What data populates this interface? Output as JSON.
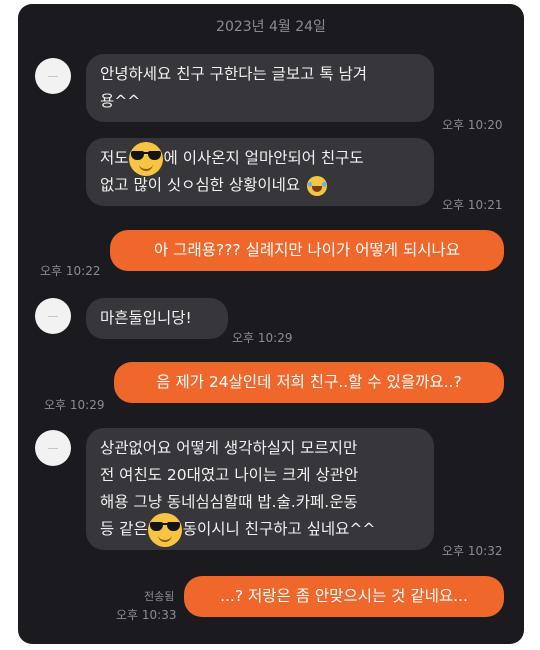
{
  "chat": {
    "date": "2023년 4월 24일",
    "messages": [
      {
        "line1": "안녕하세요 친구 구한다는 글보고 톡 남겨",
        "line2": "용^^",
        "time": "오후 10:20"
      },
      {
        "line1a": "저도",
        "line1b": "에 이사온지 얼마안되어 친구도",
        "line2": "없고 많이 싯ㅇ심한 상황이네요",
        "time": "오후 10:21",
        "emoji_a": "sunglasses-emoji",
        "emoji_b": "laughing-tears-emoji"
      },
      {
        "text": "아 그래용??? 실례지만 나이가 어떻게 되시나요",
        "time": "오후 10:22"
      },
      {
        "text": "마흔둘입니당!",
        "time": "오후 10:29"
      },
      {
        "text": "음 제가 24살인데 저희 친구..할 수 있을까요..?",
        "time": "오후 10:29"
      },
      {
        "line1": "상관없어요 어떻게 생각하실지 모르지만",
        "line2": "전 여친도 20대였고 나이는 크게 상관안",
        "line3": "해용 그냥 동네심심할때 밥.술.카페.운동",
        "line4a": "등 같은",
        "line4b": "동이시니 친구하고 싶네요^^",
        "time": "오후 10:32",
        "emoji": "sunglasses-emoji"
      },
      {
        "text": "...? 저랑은 좀 안맞으시는 것 같네요...",
        "time": "오후 10:33",
        "status": "전송됨"
      }
    ]
  },
  "colors": {
    "background": "#1b1b1f",
    "incoming": "#36363b",
    "outgoing": "#f0672b",
    "meta": "#8c8c90"
  }
}
